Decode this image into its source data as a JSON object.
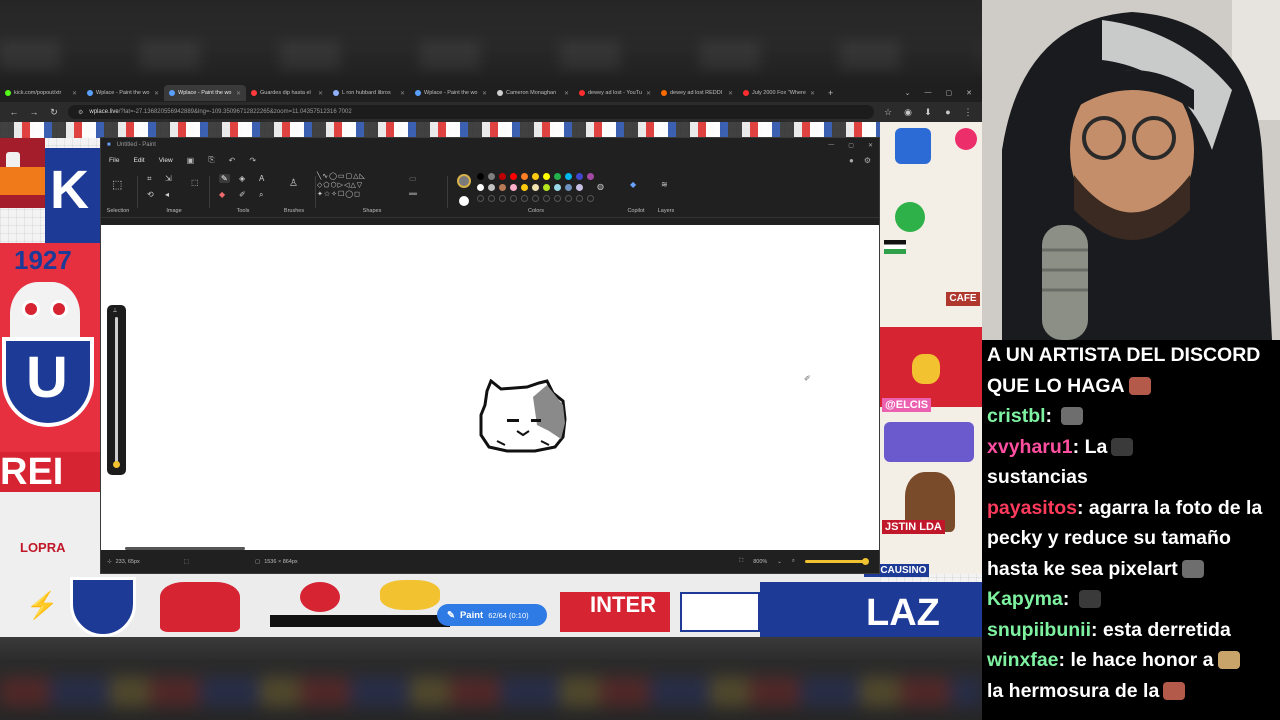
{
  "browser": {
    "tabs": [
      {
        "title": "kick.com/popout/xtr",
        "favicon_color": "#53fc18",
        "active": false
      },
      {
        "title": "Wplace - Paint the wo",
        "favicon_color": "#5aa0ff",
        "active": false
      },
      {
        "title": "Wplace - Paint the wo",
        "favicon_color": "#5aa0ff",
        "active": true
      },
      {
        "title": "Guardes dip hasta el",
        "favicon_color": "#ff3b3b",
        "active": false
      },
      {
        "title": "L ron hubbard libros",
        "favicon_color": "#8fb0ff",
        "active": false
      },
      {
        "title": "Wplace - Paint the wo",
        "favicon_color": "#5aa0ff",
        "active": false
      },
      {
        "title": "Cameron Monaghan",
        "favicon_color": "#cfcfcf",
        "active": false
      },
      {
        "title": "dewey ad lost - YouTu",
        "favicon_color": "#ff2d2d",
        "active": false
      },
      {
        "title": "dewey ad lost REDDI",
        "favicon_color": "#ff6a00",
        "active": false
      },
      {
        "title": "July 2000 Fox \"Where",
        "favicon_color": "#ff2d2d",
        "active": false
      }
    ],
    "url_host": "wplace.live",
    "url_rest": "/?lat=-27.136820556942889&lng=-109.35096712822265&zoom=11.04357512316 7002"
  },
  "paint": {
    "window_title": "Untitled - Paint",
    "menu": [
      "File",
      "Edit",
      "View"
    ],
    "groups": {
      "selection": "Selection",
      "image": "Image",
      "tools": "Tools",
      "brushes": "Brushes",
      "shapes": "Shapes",
      "colors": "Colors",
      "copilot": "Copilot",
      "layers": "Layers"
    },
    "palette": [
      "#000000",
      "#7f7f7f",
      "#c00000",
      "#ff0000",
      "#ff7f27",
      "#ffc90e",
      "#ffff00",
      "#22b14c",
      "#00b7ef",
      "#3f48cc",
      "#a349a4",
      "#ffffff",
      "#c3c3c3",
      "#b97a57",
      "#ffaec9",
      "#ffc90e",
      "#efe4b0",
      "#b5e61d",
      "#99d9ea",
      "#7092be",
      "#c8bfe7"
    ],
    "status": {
      "cursor_pos": "233, 65px",
      "canvas_size": "1536 × 864px",
      "zoom": "800%"
    }
  },
  "wplace": {
    "paint_button_label": "Paint",
    "paint_count": "62/64 (0:10)",
    "mural_texts": {
      "year": "1927",
      "cafe": "CAFE",
      "elcis": "@ELCIS",
      "inter": "INTER",
      "justin": "JSTIN LDA",
      "lacausino": "LACAUSINO"
    }
  },
  "chat": [
    {
      "user": "",
      "text": "A UN ARTISTA DEL DISCORD",
      "color": "#ffffff"
    },
    {
      "user": "",
      "text": "QUE LO HAGA",
      "color": "#ffffff",
      "emote": true
    },
    {
      "user": "cristbl",
      "text": "",
      "color": "#7ef2a1",
      "emote": true
    },
    {
      "user": "xvyharu1",
      "text": "La",
      "color": "#ff4fa0",
      "emote": true
    },
    {
      "user": "",
      "text": "sustancias",
      "color": "#ffffff"
    },
    {
      "user": "payasitos",
      "text": "agarra la foto de la",
      "color": "#ff3b5c"
    },
    {
      "user": "",
      "text": "pecky y reduce su tamaño",
      "color": "#ffffff"
    },
    {
      "user": "",
      "text": "hasta ke sea pixelart",
      "color": "#ffffff",
      "emote": true
    },
    {
      "user": "Kapyma",
      "text": "",
      "color": "#7ef2a1",
      "emote": true
    },
    {
      "user": "snupiibunii",
      "text": "esta derretida",
      "color": "#7ef2a1"
    },
    {
      "user": "winxfae",
      "text": "le hace honor a",
      "color": "#7ef2a1",
      "emote": true
    },
    {
      "user": "",
      "text": "la hermosura de la",
      "color": "#ffffff",
      "emote": true
    }
  ]
}
